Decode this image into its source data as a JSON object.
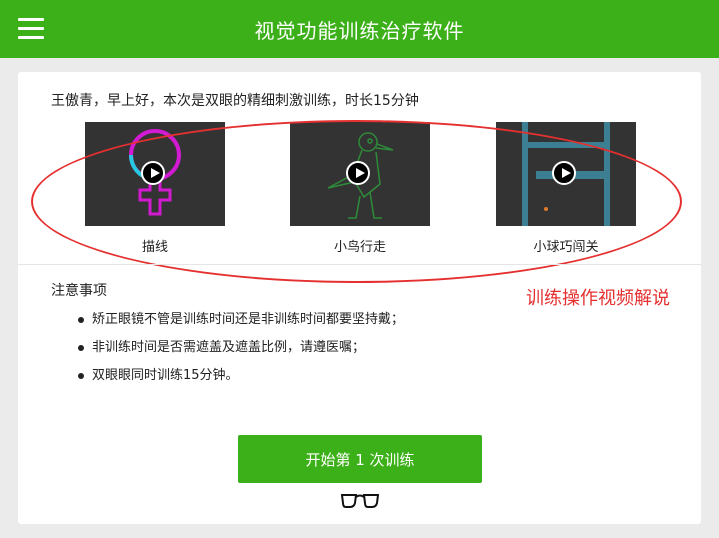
{
  "header": {
    "title": "视觉功能训练治疗软件",
    "menu_icon": "hamburger-menu-icon",
    "background_color": "#3cb019"
  },
  "main": {
    "greeting": "王傲青，早上好，本次是双眼的精细刺激训练，时长15分钟",
    "videos": [
      {
        "label": "描线",
        "icon": "play-icon"
      },
      {
        "label": "小鸟行走",
        "icon": "play-icon"
      },
      {
        "label": "小球巧闯关",
        "icon": "play-icon"
      }
    ],
    "notes": {
      "title": "注意事项",
      "items": [
        "矫正眼镜不管是训练时间还是非训练时间都要坚持戴；",
        "非训练时间是否需遮盖及遮盖比例，请遵医嘱；",
        "双眼眼同时训练15分钟。"
      ]
    },
    "annotation": "训练操作视频解说",
    "start_button": "开始第 1 次训练",
    "glasses_icon": "glasses-icon"
  },
  "colors": {
    "accent": "#3cb019",
    "annotation": "#e53030",
    "thumb_background": "#333333"
  }
}
